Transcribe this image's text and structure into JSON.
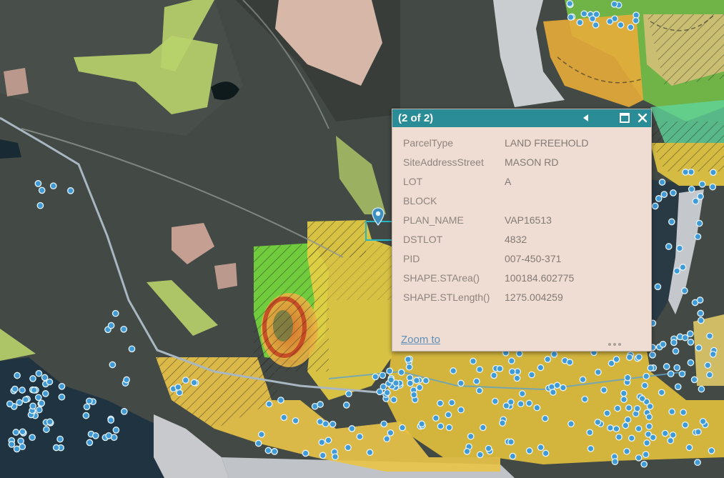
{
  "popup": {
    "counter": "(2 of 2)",
    "prev_icon": "left-triangle-icon",
    "maximize_icon": "maximize-icon",
    "close_icon": "close-x-icon",
    "zoom_label": "Zoom to",
    "more_icon": "ellipsis-icon",
    "header_color": "#2a8c96",
    "attributes": [
      {
        "key": "ParcelType",
        "value": "LAND FREEHOLD"
      },
      {
        "key": "SiteAddressStreet",
        "value": "MASON RD"
      },
      {
        "key": "LOT",
        "value": "A"
      },
      {
        "key": "BLOCK",
        "value": ""
      },
      {
        "key": "PLAN_NAME",
        "value": "VAP16513"
      },
      {
        "key": "DSTLOT",
        "value": "4832"
      },
      {
        "key": "PID",
        "value": "007-450-371"
      },
      {
        "key": "SHAPE.STArea()",
        "value": "100184.602775"
      },
      {
        "key": "SHAPE.STLength()",
        "value": "1275.004259"
      }
    ]
  },
  "map": {
    "selected_marker_icon": "location-pin-icon",
    "point_marker_icon": "blue-circle-icon",
    "colors": {
      "land": "#3f4541",
      "water": "#1f3340",
      "parcel_green": "#b9d36b",
      "zoning_yellow": "#e8cf45",
      "zoning_orange": "#e39a33",
      "bright_green": "#78e23c",
      "marker_blue": "#3f9ad6"
    }
  }
}
